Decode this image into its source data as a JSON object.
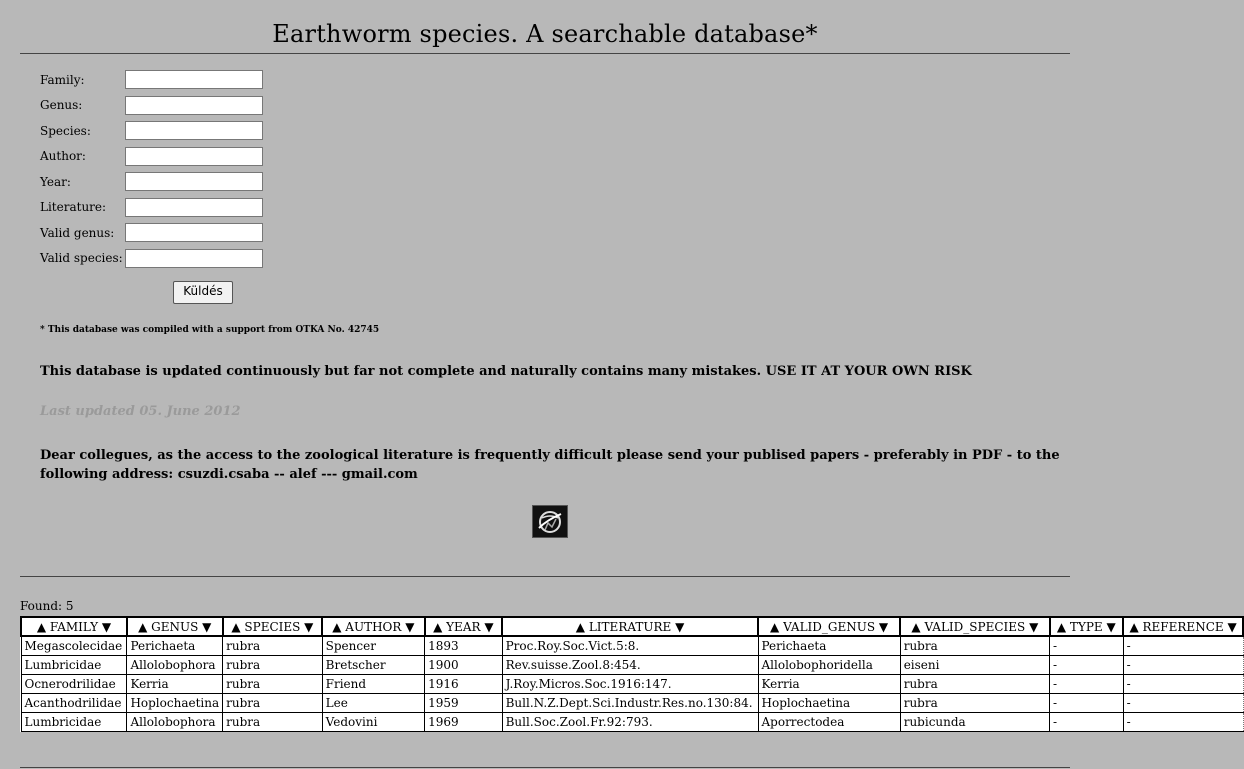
{
  "page": {
    "title": "Earthworm species. A searchable database*"
  },
  "form": {
    "fields": [
      {
        "label": "Family:",
        "value": ""
      },
      {
        "label": "Genus:",
        "value": ""
      },
      {
        "label": "Species:",
        "value": ""
      },
      {
        "label": "Author:",
        "value": ""
      },
      {
        "label": "Year:",
        "value": ""
      },
      {
        "label": "Literature:",
        "value": ""
      },
      {
        "label": "Valid genus:",
        "value": ""
      },
      {
        "label": "Valid species:",
        "value": ""
      }
    ],
    "submit_label": "Küldés"
  },
  "notes": {
    "support": "* This database was compiled with a support from OTKA No. 42745",
    "warning": "This database is updated continuously but far not complete and naturally contains many mistakes. USE IT AT YOUR OWN RISK",
    "updated": "Last updated 05. June 2012",
    "request": "Dear collegues, as the access to the zoological literature is frequently difficult please send your publised papers - preferably in PDF - to the following address: csuzdi.csaba -- alef --- gmail.com"
  },
  "logo": {
    "icon": "globe-logo-icon"
  },
  "results": {
    "found_text": "Found: 5",
    "headers": [
      "▲ FAMILY ▼",
      "▲ GENUS ▼",
      "▲ SPECIES ▼",
      "▲ AUTHOR ▼",
      "▲ YEAR ▼",
      "▲ LITERATURE ▼",
      "▲ VALID_GENUS ▼",
      "▲ VALID_SPECIES ▼",
      "▲ TYPE ▼",
      "▲ REFERENCE ▼"
    ],
    "rows": [
      [
        "Megascolecidae",
        "Perichaeta",
        "rubra",
        "Spencer",
        "1893",
        "Proc.Roy.Soc.Vict.5:8.",
        "Perichaeta",
        "rubra",
        "-",
        "-"
      ],
      [
        "Lumbricidae",
        "Allolobophora",
        "rubra",
        "Bretscher",
        "1900",
        "Rev.suisse.Zool.8:454.",
        "Allolobophoridella",
        "eiseni",
        "-",
        "-"
      ],
      [
        "Ocnerodrilidae",
        "Kerria",
        "rubra",
        "Friend",
        "1916",
        "J.Roy.Micros.Soc.1916:147.",
        "Kerria",
        "rubra",
        "-",
        "-"
      ],
      [
        "Acanthodrilidae",
        "Hoplochaetina",
        "rubra",
        "Lee",
        "1959",
        "Bull.N.Z.Dept.Sci.Industr.Res.no.130:84.",
        "Hoplochaetina",
        "rubra",
        "-",
        "-"
      ],
      [
        "Lumbricidae",
        "Allolobophora",
        "rubra",
        "Vedovini",
        "1969",
        "Bull.Soc.Zool.Fr.92:793.",
        "Aporrectodea",
        "rubicunda",
        "-",
        "-"
      ]
    ]
  }
}
